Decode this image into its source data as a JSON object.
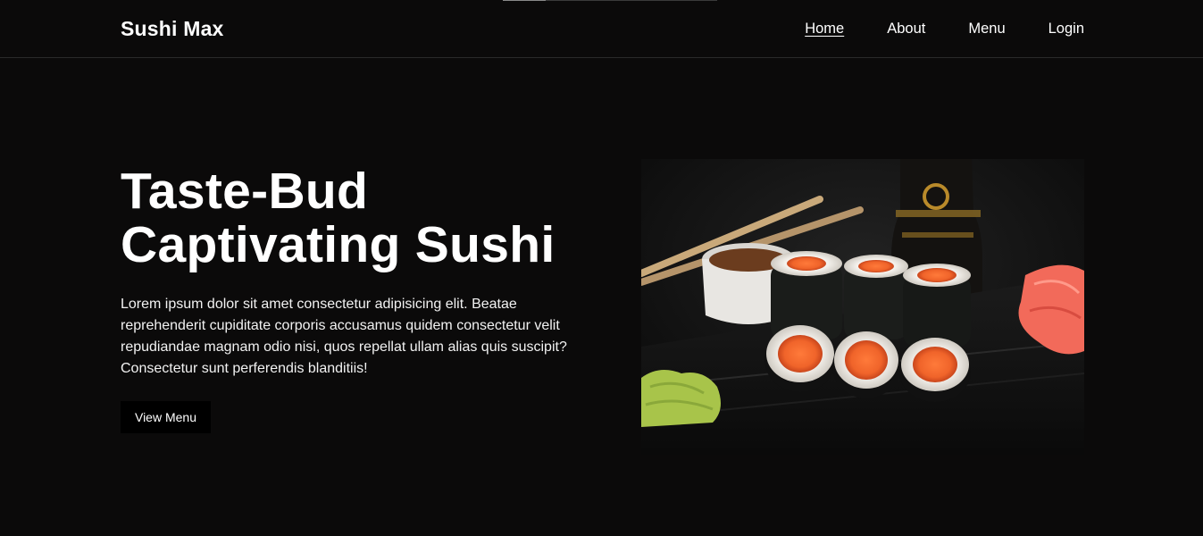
{
  "brand": "Sushi Max",
  "nav": {
    "items": [
      "Home",
      "About",
      "Menu",
      "Login"
    ],
    "active": "Home"
  },
  "hero": {
    "title": "Taste-Bud Captivating Sushi",
    "description": "Lorem ipsum dolor sit amet consectetur adipisicing elit. Beatae reprehenderit cupiditate corporis accusamus quidem consectetur velit repudiandae magnam odio nisi, quos repellat ullam alias quis suscipit? Consectetur sunt perferendis blanditiis!",
    "button_label": "View Menu",
    "image_subject": "salmon maki rolls with chopsticks, soy sauce bottle, wasabi and pickled ginger"
  },
  "colors": {
    "background": "#0b0a0a",
    "text": "#ffffff",
    "button": "#000000"
  }
}
